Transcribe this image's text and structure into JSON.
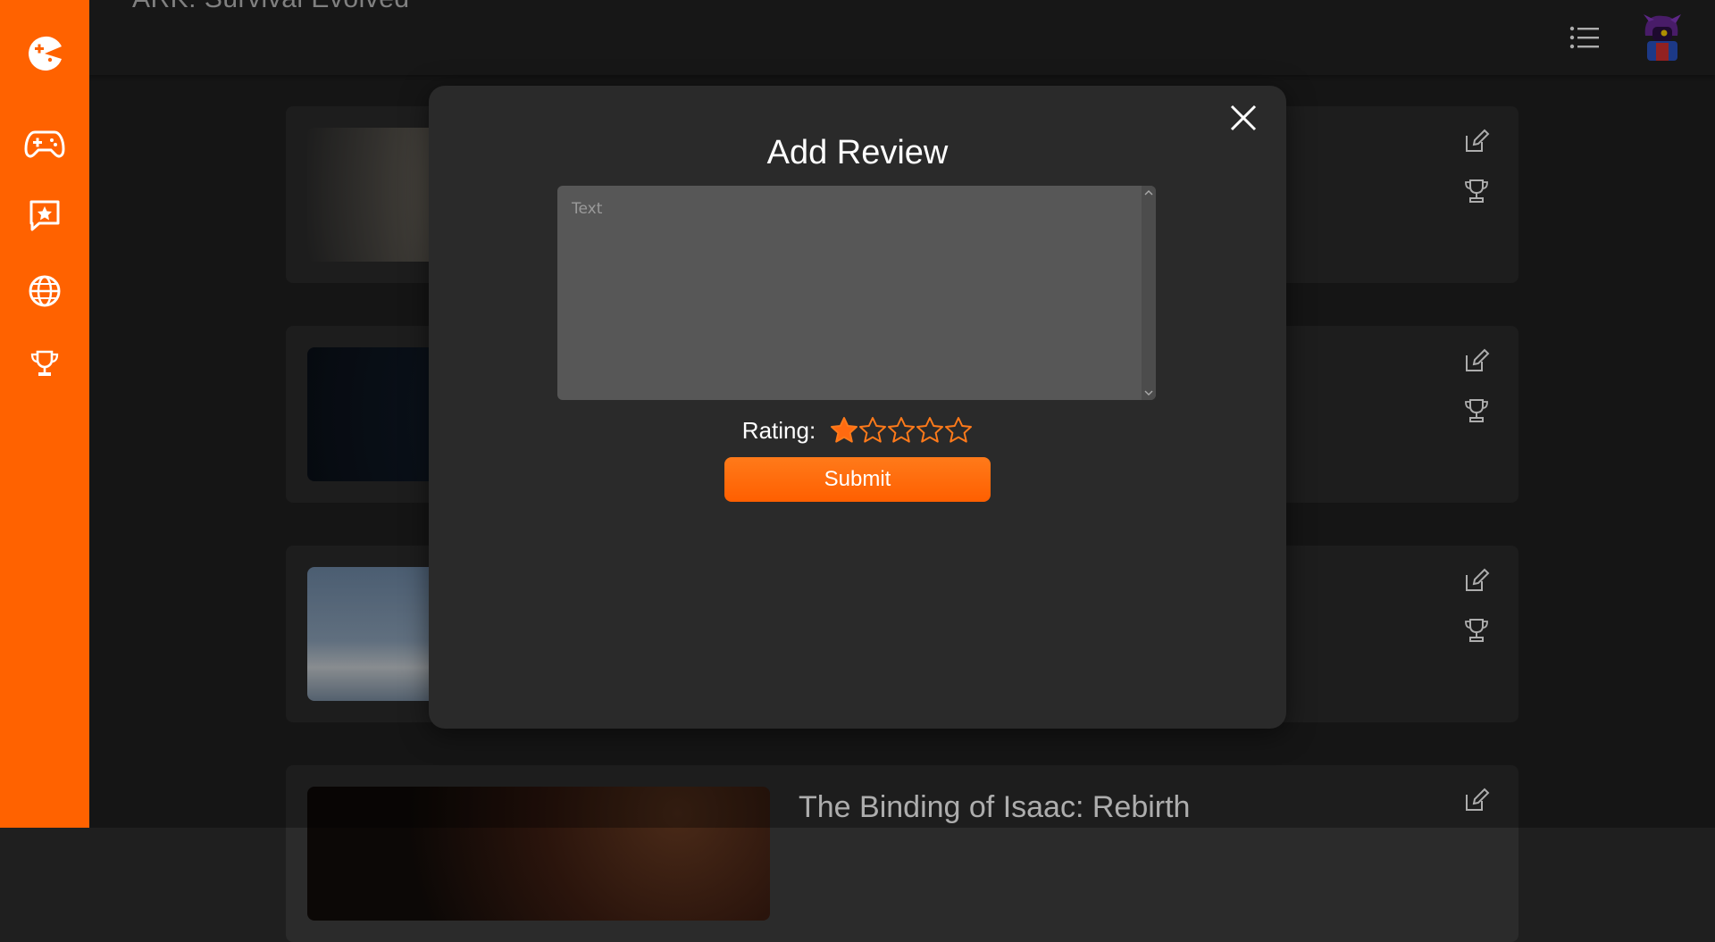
{
  "header": {
    "title": "ARK: Survival Evolved"
  },
  "sidebar": {
    "items": [
      {
        "icon": "pacman-logo-icon"
      },
      {
        "icon": "gamepad-icon"
      },
      {
        "icon": "star-message-icon"
      },
      {
        "icon": "globe-icon"
      },
      {
        "icon": "trophy-icon"
      }
    ]
  },
  "cards": [
    {
      "title": ""
    },
    {
      "title": ""
    },
    {
      "title": ""
    },
    {
      "title": "The Binding of Isaac: Rebirth"
    }
  ],
  "modal": {
    "title": "Add Review",
    "text_placeholder": "Text",
    "text_value": "",
    "rating_label": "Rating:",
    "rating_value": 1,
    "rating_max": 5,
    "submit_label": "Submit"
  },
  "colors": {
    "accent": "#ff6200",
    "modal_bg": "#2a2a2a",
    "card_bg": "#2b2b2b",
    "page_bg": "#1f1f1f"
  }
}
